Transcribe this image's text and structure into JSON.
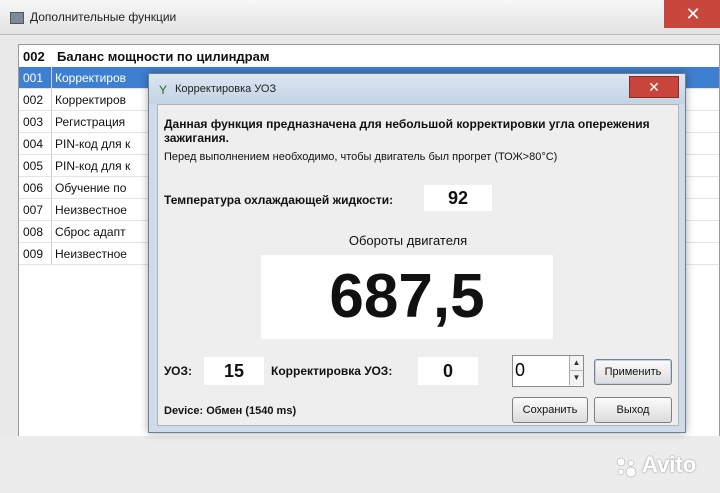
{
  "main": {
    "title": "Дополнительные функции",
    "close_glyph": "✕"
  },
  "list": {
    "header_code": "002",
    "header_name": "Баланс мощности по цилиндрам",
    "rows": [
      {
        "code": "001",
        "name": "Корректиров"
      },
      {
        "code": "002",
        "name": "Корректиров"
      },
      {
        "code": "003",
        "name": "Регистрация"
      },
      {
        "code": "004",
        "name": "PIN-код для к"
      },
      {
        "code": "005",
        "name": "PIN-код для к"
      },
      {
        "code": "006",
        "name": "Обучение по"
      },
      {
        "code": "007",
        "name": "Неизвестное"
      },
      {
        "code": "008",
        "name": "Сброс адапт"
      },
      {
        "code": "009",
        "name": "Неизвестное"
      }
    ],
    "selected_index": 0
  },
  "dialog": {
    "title": "Корректировка УОЗ",
    "close_glyph": "✕",
    "description_bold": "Данная функция предназначена для небольшой корректировки угла опережения зажигания.",
    "description_note": "Перед выполнением необходимо, чтобы двигатель был прогрет (ТОЖ>80°С)",
    "temp_label": "Температура охлаждающей жидкости:",
    "temp_value": "92",
    "rpm_label": "Обороты двигателя",
    "rpm_value": "687,5",
    "uoz_label": "УОЗ:",
    "uoz_value": "15",
    "correction_label": "Корректировка УОЗ:",
    "correction_value": "0",
    "spinner_value": "0",
    "apply_label": "Применить",
    "save_label": "Сохранить",
    "exit_label": "Выход",
    "device_status": "Device:  Обмен (1540 ms)"
  },
  "watermark": {
    "text": "Avito"
  },
  "colors": {
    "selection": "#3f7fd1",
    "close_button": "#c8453b",
    "dialog_frame": "#cfdbe8"
  }
}
